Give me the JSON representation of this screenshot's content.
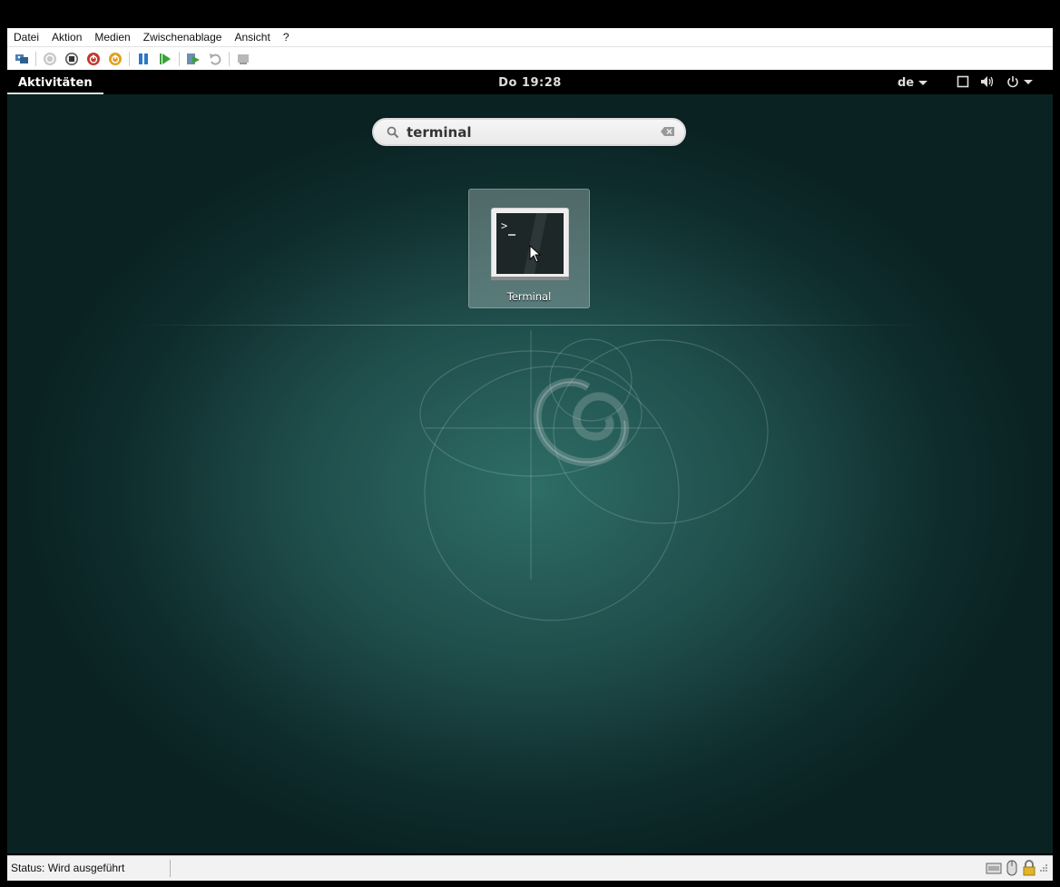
{
  "menubar": {
    "items": [
      "Datei",
      "Aktion",
      "Medien",
      "Zwischenablage",
      "Ansicht",
      "?"
    ]
  },
  "toolbar": {
    "buttons": [
      {
        "name": "ctrl-alt-del-button",
        "icon": "ctrl-alt-del-icon"
      },
      {
        "name": "start-button",
        "icon": "start-icon"
      },
      {
        "name": "turn-off-button",
        "icon": "stop-icon"
      },
      {
        "name": "shut-down-button",
        "icon": "shutdown-icon"
      },
      {
        "name": "save-button",
        "icon": "save-state-icon"
      },
      {
        "name": "pause-button",
        "icon": "pause-icon"
      },
      {
        "name": "resume-button",
        "icon": "resume-icon"
      },
      {
        "name": "checkpoint-button",
        "icon": "checkpoint-icon"
      },
      {
        "name": "revert-button",
        "icon": "revert-icon"
      },
      {
        "name": "enhanced-session-button",
        "icon": "enhanced-session-icon"
      }
    ]
  },
  "gnome": {
    "activities_label": "Aktivitäten",
    "clock": "Do 19:28",
    "keyboard_layout": "de"
  },
  "search": {
    "query": "terminal"
  },
  "results": [
    {
      "label": "Terminal",
      "icon": "terminal-app-icon"
    }
  ],
  "statusbar": {
    "text": "Status: Wird ausgeführt"
  },
  "colors": {
    "background_center": "#2f6d67",
    "background_edge": "#0a2222",
    "topbar": "#000000"
  }
}
